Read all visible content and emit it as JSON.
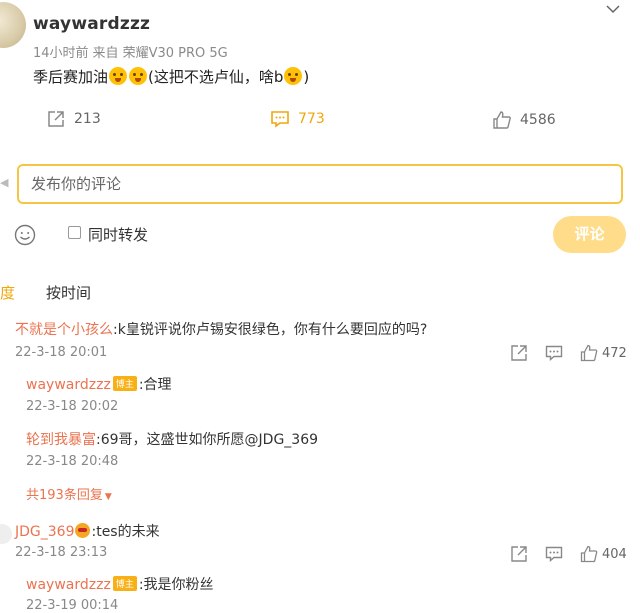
{
  "post": {
    "author": "waywardzzz",
    "time": "14小时前",
    "source_prefix": "来自",
    "device": "荣耀V30 PRO 5G",
    "text_parts": [
      "季后赛加油",
      "(这把不选卢仙，啥b",
      ")"
    ],
    "share_count": "213",
    "comment_count": "773",
    "like_count": "4586"
  },
  "composer": {
    "placeholder": "发布你的评论",
    "repost_label": "同时转发",
    "submit_label": "评论"
  },
  "sort": {
    "hot_label": "度",
    "time_label": "按时间"
  },
  "comments": [
    {
      "author": "不就是个小孩么",
      "text": ":k皇锐评说你卢锡安很绿色，你有什么要回应的吗?",
      "date": "22-3-18 20:01",
      "likes": "472",
      "replies": [
        {
          "author": "waywardzzz",
          "badge": "博主",
          "text": ":合理",
          "date": "22-3-18 20:02"
        },
        {
          "author": "轮到我暴富",
          "text": ":69哥，这盛世如你所愿@JDG_369",
          "date": "22-3-18 20:48"
        }
      ],
      "more_replies": "共193条回复"
    },
    {
      "author": "JDG_369",
      "text": ":tes的未来",
      "date": "22-3-18 23:13",
      "likes": "404",
      "replies": [
        {
          "author": "waywardzzz",
          "badge": "博主",
          "text": ":我是你粉丝",
          "date": "22-3-19 00:14"
        }
      ]
    }
  ],
  "colors": {
    "accent": "#f0a70a",
    "name": "#eb7350",
    "input_border": "#f5c646",
    "button_bg": "#fedc8a"
  }
}
